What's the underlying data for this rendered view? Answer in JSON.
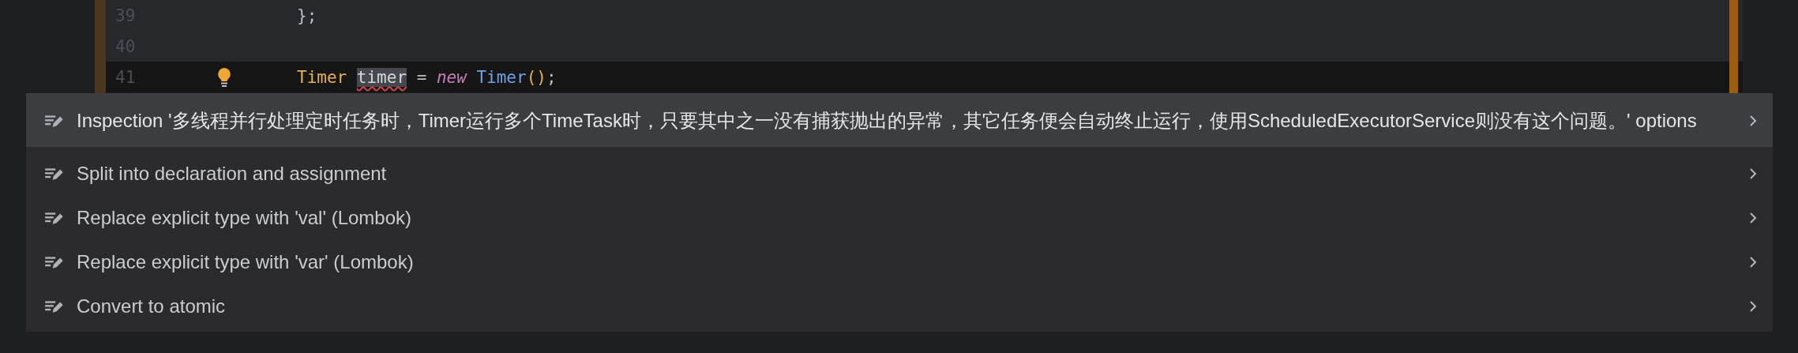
{
  "editor": {
    "lines": [
      {
        "number": "39",
        "current": false,
        "bulb": false,
        "tokens": [
          {
            "text": "};",
            "kind": "punct",
            "space_before": false
          }
        ]
      },
      {
        "number": "40",
        "current": false,
        "bulb": false
      },
      {
        "number": "41",
        "current": true,
        "bulb": true,
        "tokens": [
          {
            "text": "Timer",
            "kind": "type",
            "space_before": false
          },
          {
            "text": "timer",
            "kind": "flagged",
            "space_before": true
          },
          {
            "text": "=",
            "kind": "op",
            "space_before": true
          },
          {
            "text": "new",
            "kind": "keyword",
            "space_before": true
          },
          {
            "text": "Timer",
            "kind": "class",
            "space_before": true
          },
          {
            "text": "()",
            "kind": "paren",
            "space_before": false
          },
          {
            "text": ";",
            "kind": "punct",
            "space_before": false
          }
        ]
      }
    ]
  },
  "intention_menu": {
    "items": [
      {
        "label": "Inspection '多线程并行处理定时任务时，Timer运行多个TimeTask时，只要其中之一没有捕获抛出的异常，其它任务便会自动终止运行，使用ScheduledExecutorService则没有这个问题。' options",
        "selected": true
      },
      {
        "label": "Split into declaration and assignment",
        "selected": false
      },
      {
        "label": "Replace explicit type with 'val' (Lombok)",
        "selected": false
      },
      {
        "label": "Replace explicit type with 'var' (Lombok)",
        "selected": false
      },
      {
        "label": "Convert to atomic",
        "selected": false
      }
    ]
  }
}
